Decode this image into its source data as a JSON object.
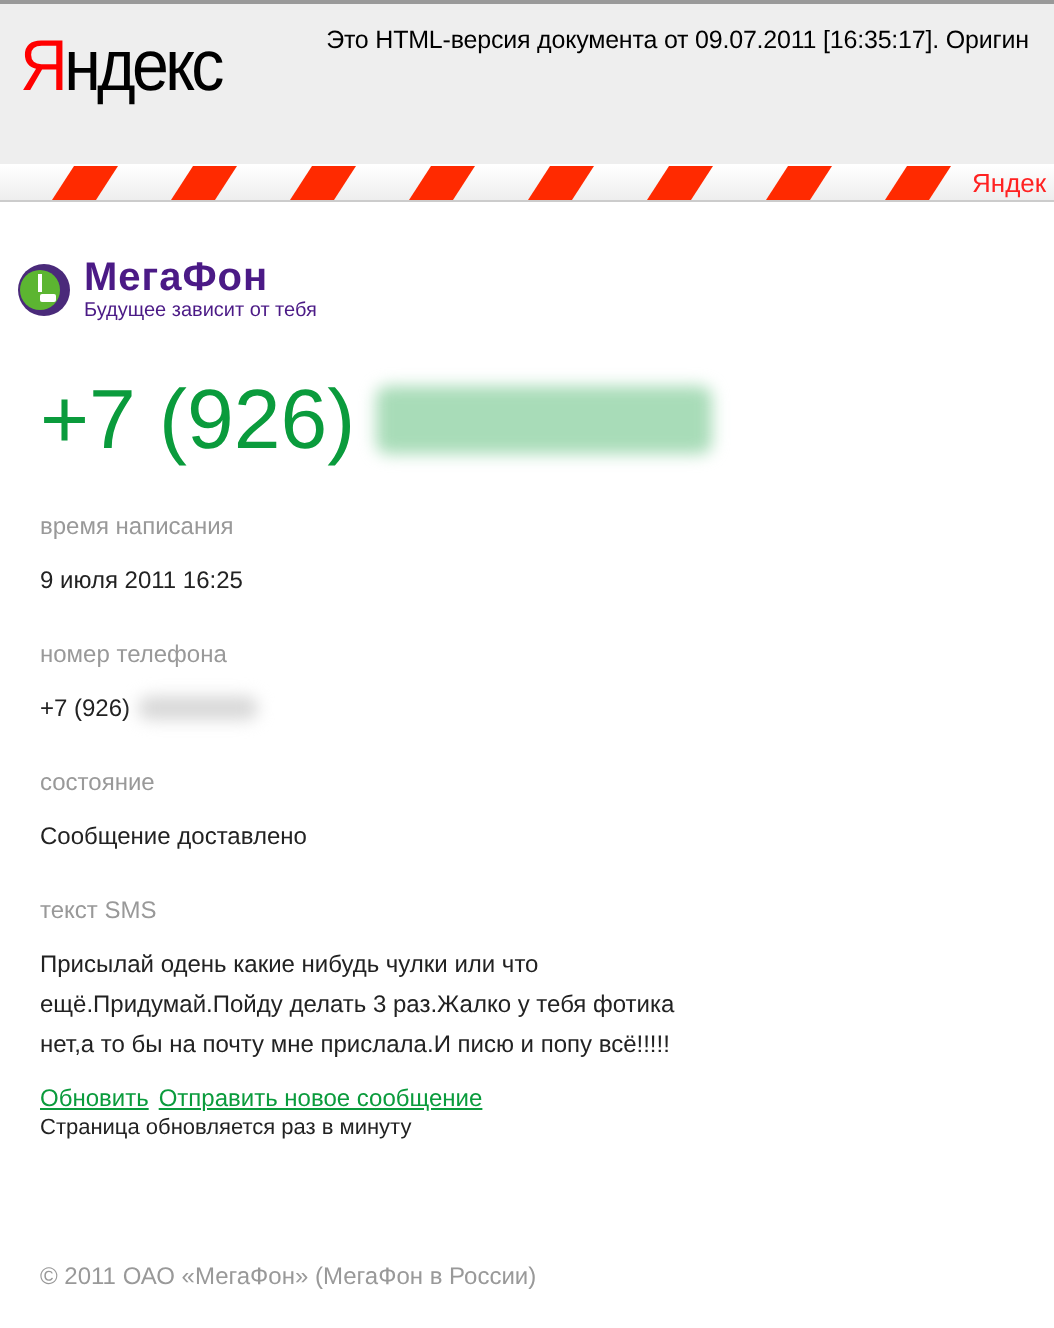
{
  "header": {
    "logo": "Яндекс",
    "notice": "Это HTML-версия документа от 09.07.2011 [16:35:17]. Оригин",
    "stripe_label": "Яндек"
  },
  "brand": {
    "name": "МегаФон",
    "tagline": "Будущее зависит от тебя"
  },
  "phone_heading": "+7 (926)",
  "fields": [
    {
      "label": "время написания",
      "value": "9 июля 2011 16:25",
      "kind": "text"
    },
    {
      "label": "номер телефона",
      "value": "+7 (926)",
      "kind": "phone"
    },
    {
      "label": "состояние",
      "value": "Сообщение доставлено",
      "kind": "text"
    },
    {
      "label": "текст SMS",
      "value": "Присылай одень какие нибудь чулки или что ещё.Придумай.Пойду делать 3 раз.Жалко у тебя фотика нет,а то бы на почту мне прислала.И писю и попу всё!!!!!",
      "kind": "text"
    }
  ],
  "links": [
    "Обновить",
    "Отправить новое сообщение"
  ],
  "refresh_note": "Страница обновляется раз в минуту",
  "footer": "© 2011 ОАО «МегаФон» (МегаФон в России)"
}
